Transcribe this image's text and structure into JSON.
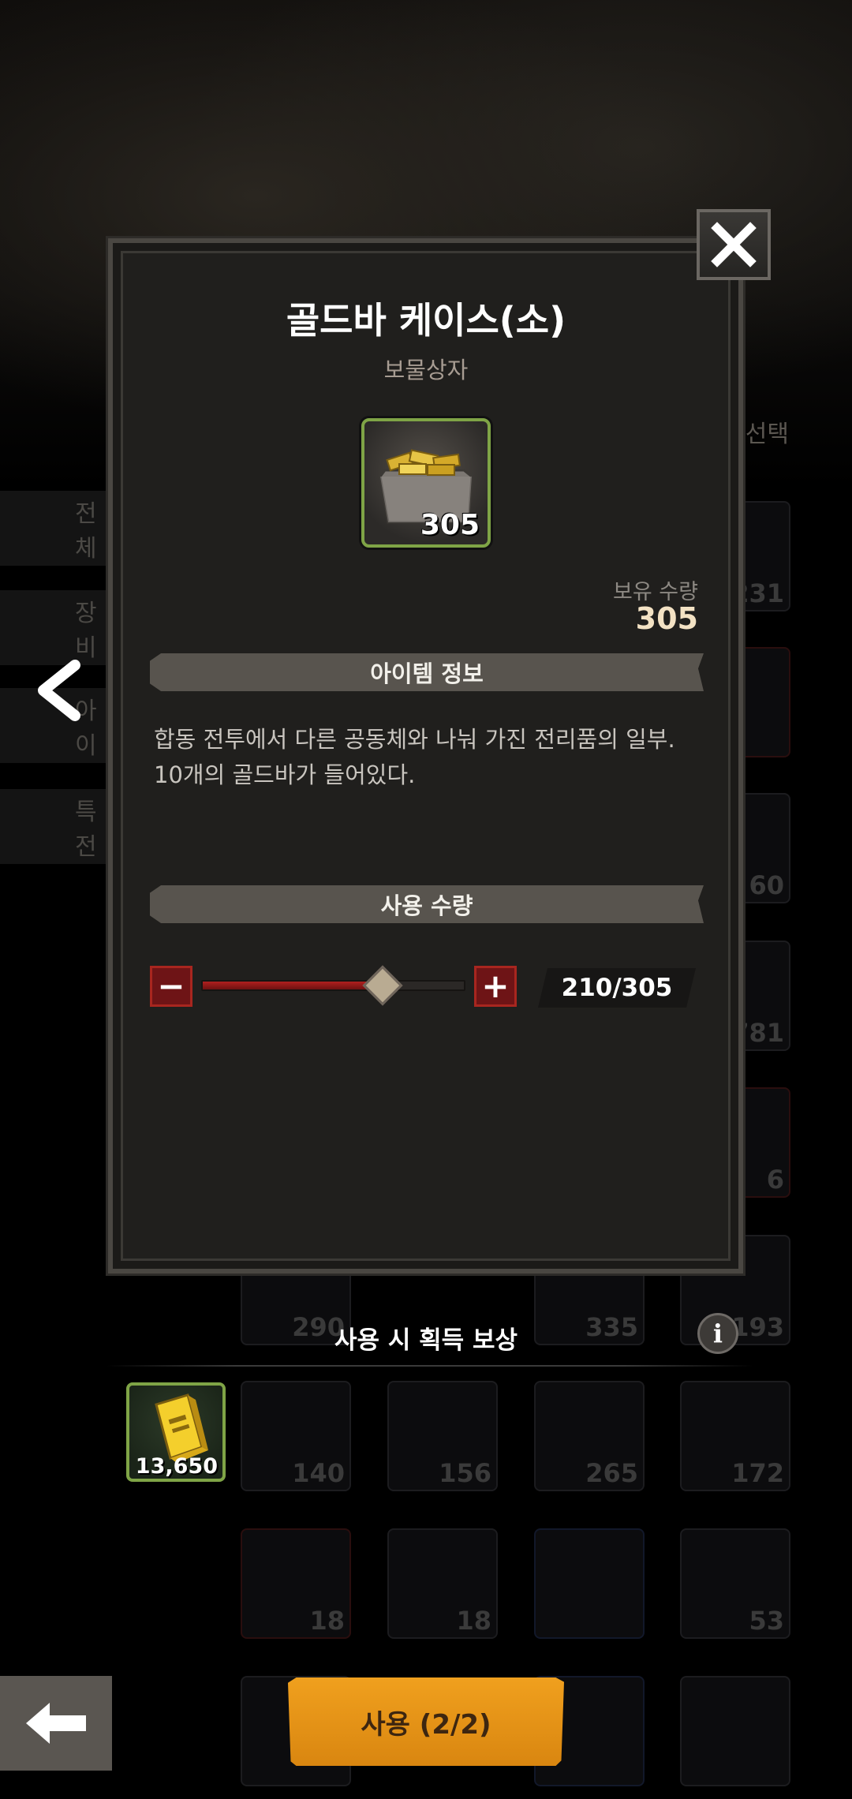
{
  "background": {
    "select_label": "선택",
    "left_tabs": [
      "전체",
      "장비",
      "아이",
      "특전"
    ],
    "slot_counts": [
      "231",
      "60",
      "781",
      "6",
      "290",
      "335",
      "193",
      "140",
      "156",
      "265",
      "172",
      "18",
      "18",
      "53"
    ]
  },
  "modal": {
    "title": "골드바 케이스(소)",
    "subtitle": "보물상자",
    "item_icon": "gold-bar-case-icon",
    "item_count": "305",
    "hold_label": "보유 수량",
    "hold_value": "305",
    "info_section_label": "아이템 정보",
    "description_lines": [
      "합동 전투에서 다른 공동체와 나눠 가진 전리품의 일부.",
      "10개의 골드바가 들어있다."
    ],
    "quantity_section_label": "사용 수량",
    "minus_label": "−",
    "plus_label": "+",
    "quantity_display": "210/305",
    "slider_fraction": 0.688
  },
  "reward": {
    "title": "사용 시 획득 보상",
    "info_label": "i",
    "item_icon": "gold-bar-icon",
    "item_count": "13,650"
  },
  "bottom": {
    "back_icon": "back-arrow-icon",
    "use_label": "사용 (2/2)"
  },
  "colors": {
    "accent_orange": "#f0a01e",
    "frame_green": "#7fa446",
    "minus_plus_red": "#6e1416",
    "slider_red": "#b0201f"
  }
}
